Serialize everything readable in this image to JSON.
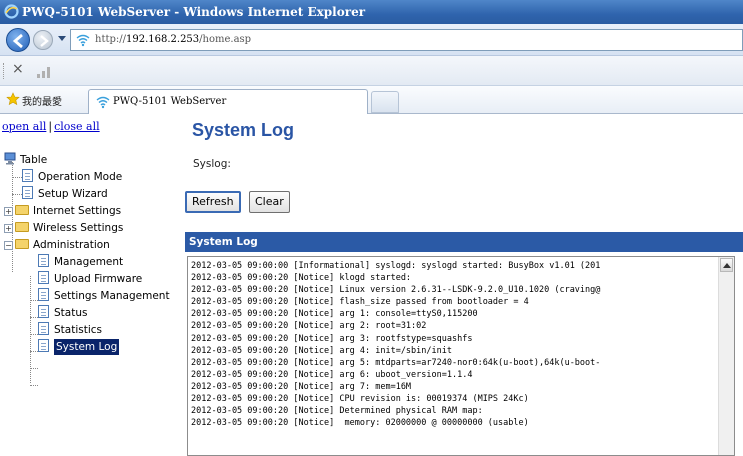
{
  "window": {
    "title": "PWQ-5101 WebServer - Windows Internet Explorer"
  },
  "address": {
    "prefix": "http://",
    "host": "192.168.2.253",
    "path": "/home.asp"
  },
  "favorites": {
    "label": "我的最愛",
    "tab_title": "PWQ-5101 WebServer"
  },
  "toolbar": {
    "close_glyph": "×"
  },
  "sidebar": {
    "open_all": "open all",
    "separator": "|",
    "close_all": "close all",
    "tree": {
      "root": "Table",
      "items": [
        "Operation Mode",
        "Setup Wizard",
        "Internet Settings",
        "Wireless Settings",
        "Administration",
        "Management",
        "Upload Firmware",
        "Settings Management",
        "Status",
        "Statistics",
        "System Log"
      ],
      "selected": "System Log"
    }
  },
  "main": {
    "title": "System Log",
    "syslog_label": "Syslog:",
    "refresh_label": "Refresh",
    "clear_label": "Clear",
    "panel_title": "System Log",
    "log_lines": [
      "2012-03-05 09:00:00 [Informational] syslogd: syslogd started: BusyBox v1.01 (201",
      "2012-03-05 09:00:20 [Notice] klogd started:",
      "2012-03-05 09:00:20 [Notice] Linux version 2.6.31--LSDK-9.2.0_U10.1020 (craving@",
      "2012-03-05 09:00:20 [Notice] flash_size passed from bootloader = 4",
      "2012-03-05 09:00:20 [Notice] arg 1: console=ttyS0,115200",
      "2012-03-05 09:00:20 [Notice] arg 2: root=31:02",
      "2012-03-05 09:00:20 [Notice] arg 3: rootfstype=squashfs",
      "2012-03-05 09:00:20 [Notice] arg 4: init=/sbin/init",
      "2012-03-05 09:00:20 [Notice] arg 5: mtdparts=ar7240-nor0:64k(u-boot),64k(u-boot-",
      "2012-03-05 09:00:20 [Notice] arg 6: uboot_version=1.1.4",
      "2012-03-05 09:00:20 [Notice] arg 7: mem=16M",
      "2012-03-05 09:00:20 [Notice] CPU revision is: 00019374 (MIPS 24Kc)",
      "2012-03-05 09:00:20 [Notice] Determined physical RAM map:",
      "2012-03-05 09:00:20 [Notice]  memory: 02000000 @ 00000000 (usable)"
    ]
  }
}
